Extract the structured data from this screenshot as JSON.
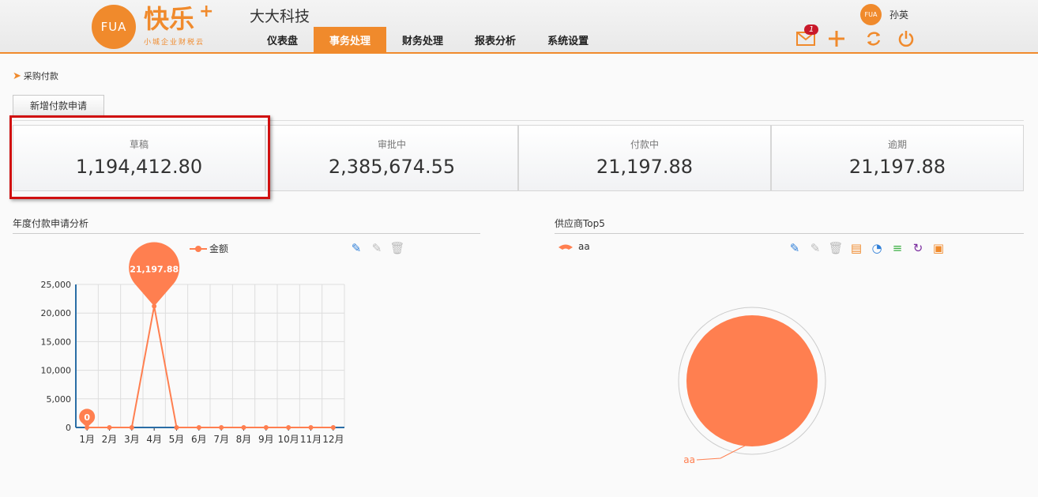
{
  "header": {
    "logo_text": "FUA",
    "logo_word": "快乐",
    "logo_plus": "+",
    "logo_tagline": "小城企业财税云",
    "company": "大大科技",
    "user_name": "孙英",
    "mail_badge": "1",
    "nav": [
      "仪表盘",
      "事务处理",
      "财务处理",
      "报表分析",
      "系统设置"
    ],
    "active_nav": "事务处理",
    "accent_color": "#f08a2c",
    "icons": [
      "mail-icon",
      "add-icon",
      "refresh-icon",
      "power-icon"
    ]
  },
  "breadcrumb": "采购付款",
  "new_button": "新增付款申请",
  "cards": [
    {
      "label": "草稿",
      "value": "1,194,412.80"
    },
    {
      "label": "审批中",
      "value": "2,385,674.55"
    },
    {
      "label": "付款中",
      "value": "21,197.88"
    },
    {
      "label": "逾期",
      "value": "21,197.88"
    }
  ],
  "left_panel": {
    "title": "年度付款申请分析",
    "legend": "金额"
  },
  "right_panel": {
    "title": "供应商Top5",
    "legend": "aa"
  },
  "chart_data": [
    {
      "type": "line",
      "title": "年度付款申请分析",
      "categories": [
        "1月",
        "2月",
        "3月",
        "4月",
        "5月",
        "6月",
        "7月",
        "8月",
        "9月",
        "10月",
        "11月",
        "12月"
      ],
      "series": [
        {
          "name": "金额",
          "values": [
            0,
            0,
            0,
            21197.88,
            0,
            0,
            0,
            0,
            0,
            0,
            0,
            0
          ]
        }
      ],
      "ylim": [
        0,
        25000
      ],
      "yticks": [
        "0",
        "5,000",
        "10,000",
        "15,000",
        "20,000",
        "25,000"
      ],
      "markers": [
        {
          "label": "21,197.88",
          "index": 3
        },
        {
          "label": "0",
          "index": 0
        }
      ],
      "grid": true,
      "legend_position": "top-center",
      "color": "#ff7f50"
    },
    {
      "type": "pie",
      "title": "供应商Top5",
      "labels": [
        "aa"
      ],
      "values": [
        21197.88
      ],
      "legend_position": "top-left",
      "color": "#ff7f50"
    }
  ]
}
